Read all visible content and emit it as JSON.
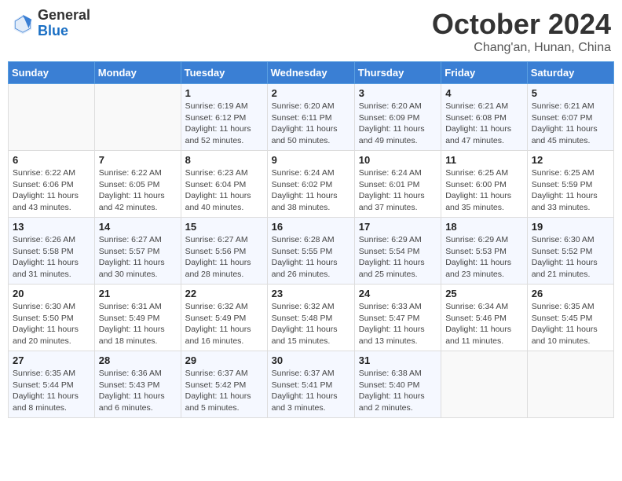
{
  "header": {
    "logo_general": "General",
    "logo_blue": "Blue",
    "month_title": "October 2024",
    "location": "Chang'an, Hunan, China"
  },
  "weekdays": [
    "Sunday",
    "Monday",
    "Tuesday",
    "Wednesday",
    "Thursday",
    "Friday",
    "Saturday"
  ],
  "weeks": [
    [
      {
        "day": "",
        "info": ""
      },
      {
        "day": "",
        "info": ""
      },
      {
        "day": "1",
        "info": "Sunrise: 6:19 AM\nSunset: 6:12 PM\nDaylight: 11 hours and 52 minutes."
      },
      {
        "day": "2",
        "info": "Sunrise: 6:20 AM\nSunset: 6:11 PM\nDaylight: 11 hours and 50 minutes."
      },
      {
        "day": "3",
        "info": "Sunrise: 6:20 AM\nSunset: 6:09 PM\nDaylight: 11 hours and 49 minutes."
      },
      {
        "day": "4",
        "info": "Sunrise: 6:21 AM\nSunset: 6:08 PM\nDaylight: 11 hours and 47 minutes."
      },
      {
        "day": "5",
        "info": "Sunrise: 6:21 AM\nSunset: 6:07 PM\nDaylight: 11 hours and 45 minutes."
      }
    ],
    [
      {
        "day": "6",
        "info": "Sunrise: 6:22 AM\nSunset: 6:06 PM\nDaylight: 11 hours and 43 minutes."
      },
      {
        "day": "7",
        "info": "Sunrise: 6:22 AM\nSunset: 6:05 PM\nDaylight: 11 hours and 42 minutes."
      },
      {
        "day": "8",
        "info": "Sunrise: 6:23 AM\nSunset: 6:04 PM\nDaylight: 11 hours and 40 minutes."
      },
      {
        "day": "9",
        "info": "Sunrise: 6:24 AM\nSunset: 6:02 PM\nDaylight: 11 hours and 38 minutes."
      },
      {
        "day": "10",
        "info": "Sunrise: 6:24 AM\nSunset: 6:01 PM\nDaylight: 11 hours and 37 minutes."
      },
      {
        "day": "11",
        "info": "Sunrise: 6:25 AM\nSunset: 6:00 PM\nDaylight: 11 hours and 35 minutes."
      },
      {
        "day": "12",
        "info": "Sunrise: 6:25 AM\nSunset: 5:59 PM\nDaylight: 11 hours and 33 minutes."
      }
    ],
    [
      {
        "day": "13",
        "info": "Sunrise: 6:26 AM\nSunset: 5:58 PM\nDaylight: 11 hours and 31 minutes."
      },
      {
        "day": "14",
        "info": "Sunrise: 6:27 AM\nSunset: 5:57 PM\nDaylight: 11 hours and 30 minutes."
      },
      {
        "day": "15",
        "info": "Sunrise: 6:27 AM\nSunset: 5:56 PM\nDaylight: 11 hours and 28 minutes."
      },
      {
        "day": "16",
        "info": "Sunrise: 6:28 AM\nSunset: 5:55 PM\nDaylight: 11 hours and 26 minutes."
      },
      {
        "day": "17",
        "info": "Sunrise: 6:29 AM\nSunset: 5:54 PM\nDaylight: 11 hours and 25 minutes."
      },
      {
        "day": "18",
        "info": "Sunrise: 6:29 AM\nSunset: 5:53 PM\nDaylight: 11 hours and 23 minutes."
      },
      {
        "day": "19",
        "info": "Sunrise: 6:30 AM\nSunset: 5:52 PM\nDaylight: 11 hours and 21 minutes."
      }
    ],
    [
      {
        "day": "20",
        "info": "Sunrise: 6:30 AM\nSunset: 5:50 PM\nDaylight: 11 hours and 20 minutes."
      },
      {
        "day": "21",
        "info": "Sunrise: 6:31 AM\nSunset: 5:49 PM\nDaylight: 11 hours and 18 minutes."
      },
      {
        "day": "22",
        "info": "Sunrise: 6:32 AM\nSunset: 5:49 PM\nDaylight: 11 hours and 16 minutes."
      },
      {
        "day": "23",
        "info": "Sunrise: 6:32 AM\nSunset: 5:48 PM\nDaylight: 11 hours and 15 minutes."
      },
      {
        "day": "24",
        "info": "Sunrise: 6:33 AM\nSunset: 5:47 PM\nDaylight: 11 hours and 13 minutes."
      },
      {
        "day": "25",
        "info": "Sunrise: 6:34 AM\nSunset: 5:46 PM\nDaylight: 11 hours and 11 minutes."
      },
      {
        "day": "26",
        "info": "Sunrise: 6:35 AM\nSunset: 5:45 PM\nDaylight: 11 hours and 10 minutes."
      }
    ],
    [
      {
        "day": "27",
        "info": "Sunrise: 6:35 AM\nSunset: 5:44 PM\nDaylight: 11 hours and 8 minutes."
      },
      {
        "day": "28",
        "info": "Sunrise: 6:36 AM\nSunset: 5:43 PM\nDaylight: 11 hours and 6 minutes."
      },
      {
        "day": "29",
        "info": "Sunrise: 6:37 AM\nSunset: 5:42 PM\nDaylight: 11 hours and 5 minutes."
      },
      {
        "day": "30",
        "info": "Sunrise: 6:37 AM\nSunset: 5:41 PM\nDaylight: 11 hours and 3 minutes."
      },
      {
        "day": "31",
        "info": "Sunrise: 6:38 AM\nSunset: 5:40 PM\nDaylight: 11 hours and 2 minutes."
      },
      {
        "day": "",
        "info": ""
      },
      {
        "day": "",
        "info": ""
      }
    ]
  ]
}
